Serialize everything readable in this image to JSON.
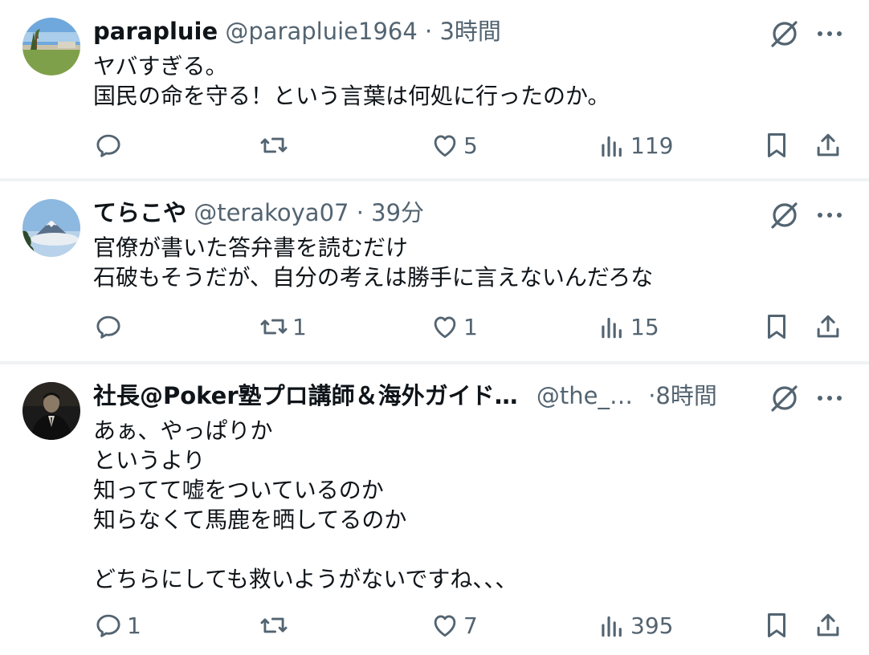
{
  "tweets": [
    {
      "name": "parapluie",
      "handle": "@parapluie1964",
      "separator": "·",
      "time": "3時間",
      "lines": [
        "ヤバすぎる。",
        "国民の命を守る！という言葉は何処に行ったのか。"
      ],
      "replies": "",
      "retweets": "",
      "likes": "5",
      "views": "119",
      "avatar": "landscape-garden"
    },
    {
      "name": "てらこや",
      "handle": "@terakoya07",
      "separator": "·",
      "time": "39分",
      "lines": [
        "官僚が書いた答弁書を読むだけ",
        "石破もそうだが、自分の考えは勝手に言えないんだろな"
      ],
      "replies": "",
      "retweets": "1",
      "likes": "1",
      "views": "15",
      "avatar": "mount-fuji"
    },
    {
      "name": "社長@Poker塾プロ講師＆海外ガイド…",
      "handle": "@the_…",
      "separator": "·",
      "time": "8時間",
      "lines": [
        "あぁ、やっぱりか",
        "というより",
        "知ってて嘘をついているのか",
        "知らなくて馬鹿を晒してるのか",
        "",
        "どちらにしても救いようがないですね、、、"
      ],
      "replies": "1",
      "retweets": "",
      "likes": "7",
      "views": "395",
      "avatar": "man-in-suit"
    }
  ],
  "icons": {
    "reply": "reply-icon",
    "retweet": "retweet-icon",
    "like": "heart-icon",
    "views": "views-icon",
    "bookmark": "bookmark-icon",
    "share": "share-icon",
    "grok": "grok-icon",
    "more": "more-icon"
  },
  "colors": {
    "text": "#0f1419",
    "secondary": "#536471",
    "divider": "#eff3f4"
  }
}
